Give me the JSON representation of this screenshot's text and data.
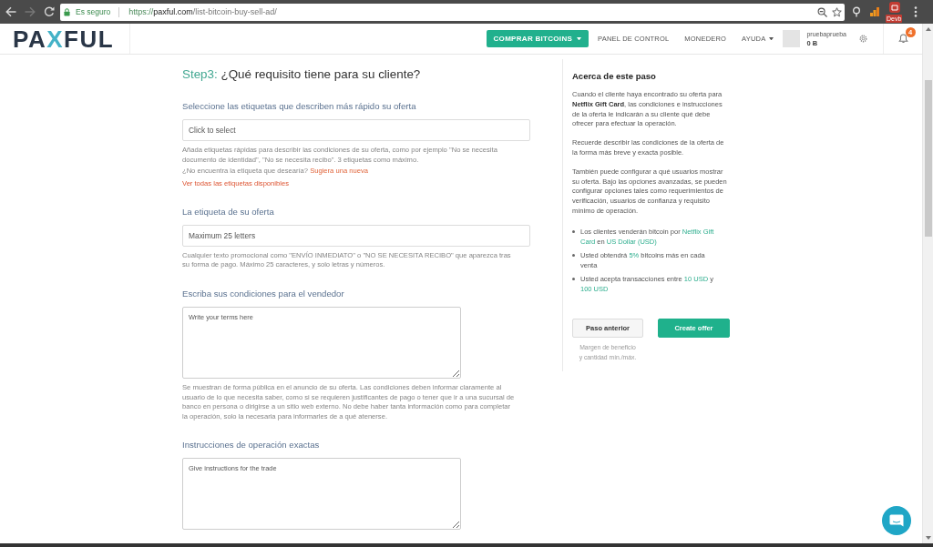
{
  "browser": {
    "nav_buttons": [
      {
        "kind": "back",
        "disabled": false
      },
      {
        "kind": "forward",
        "disabled": true
      },
      {
        "kind": "reload",
        "disabled": false
      }
    ],
    "security_label": "Es seguro",
    "url": {
      "scheme": "https://",
      "host": "paxful.com",
      "path": "/list-bitcoin-buy-sell-ad/"
    },
    "extensions": [
      {
        "kind": "pin"
      },
      {
        "kind": "chart"
      },
      {
        "kind": "badge",
        "badge": "Devb"
      }
    ]
  },
  "header": {
    "logo": [
      {
        "text": "PA",
        "accent": false
      },
      {
        "text": "X",
        "accent": true
      },
      {
        "text": "FUL",
        "accent": false
      }
    ],
    "buy_button": {
      "label": "COMPRAR BITCOINS",
      "has_menu": true
    },
    "nav": [
      {
        "label": "PANEL DE CONTROL",
        "has_menu": false
      },
      {
        "label": "MONEDERO",
        "has_menu": false
      },
      {
        "label": "AYUDA",
        "has_menu": true
      }
    ],
    "user": {
      "name": "pruebaprueba",
      "balance": "0 Ƀ"
    },
    "notifications": {
      "count": "4"
    }
  },
  "form": {
    "step_label": "Step3:",
    "title": "¿Qué requisito tiene para su cliente?",
    "sections": [
      {
        "kind": "select",
        "label": "Seleccione las etiquetas que describen más rápido su oferta",
        "placeholder": "Click to select",
        "help": "Añada etiquetas rápidas para describir las condiciones de su oferta, como por ejemplo \"No se necesita documento de identidad\", \"No se necesita recibo\". 3 etiquetas como máximo.",
        "prompt": "¿No encuentra la etiqueta que desearía?",
        "prompt_link": "Sugiera una nueva",
        "link": "Ver todas las etiquetas disponibles"
      },
      {
        "kind": "input",
        "label": "La etiqueta de su oferta",
        "placeholder": "Maximum 25 letters",
        "help": "Cualquier texto promocional como \"ENVÍO INMEDIATO\" o \"NO SE NECESITA RECIBO\" que aparezca tras su forma de pago. Máximo 25 caracteres, y solo letras y números."
      },
      {
        "kind": "textarea",
        "label": "Escriba sus condiciones para el vendedor",
        "placeholder": "Write your terms here",
        "help": "Se muestran de forma pública en el anuncio de su oferta. Las condiciones deben informar claramente al usuario de lo que necesita saber, como si se requieren justificantes de pago o tener que ir a una sucursal de banco en persona o dirigirse a un sitio web externo. No debe haber tanta información como para completar la operación, solo la necesaria para informarles de a qué atenerse."
      },
      {
        "kind": "textarea",
        "label": "Instrucciones de operación exactas",
        "placeholder": "Give instructions for the trade"
      }
    ]
  },
  "sidebar": {
    "title": "Acerca de este paso",
    "paragraphs": [
      "Cuando el cliente haya encontrado su oferta para **Netflix Gift Card**, las condiciones e instrucciones de la oferta le indicarán a su cliente qué debe ofrecer para efectuar la operación.",
      "Recuerde describir las condiciones de la oferta de la forma más breve y exacta posible.",
      "También puede configurar a qué usuarios mostrar su oferta. Bajo las opciones avanzadas, se pueden configurar opciones tales como requerimientos de verificación, usuarios de confianza y requisito mínimo de operación."
    ],
    "summary": [
      {
        "parts": [
          {
            "text": "Los clientes venderán bitcoin por ",
            "highlight": false
          },
          {
            "text": "Netflix Gift Card",
            "highlight": true
          },
          {
            "text": " en ",
            "highlight": false
          },
          {
            "text": "US Dollar (USD)",
            "highlight": true
          }
        ]
      },
      {
        "parts": [
          {
            "text": "Usted obtendrá ",
            "highlight": false
          },
          {
            "text": "5%",
            "highlight": true
          },
          {
            "text": " bitcoins más en cada venta",
            "highlight": false
          }
        ]
      },
      {
        "parts": [
          {
            "text": "Usted acepta transacciones entre ",
            "highlight": false
          },
          {
            "text": "10 USD",
            "highlight": true
          },
          {
            "text": " y ",
            "highlight": false
          },
          {
            "text": "100 USD",
            "highlight": true
          }
        ]
      }
    ],
    "buttons": [
      {
        "kind": "secondary",
        "label": "Paso anterior",
        "caption": "Margen de beneficio y cantidad mín./máx."
      },
      {
        "kind": "primary",
        "label": "Create offer"
      }
    ]
  }
}
